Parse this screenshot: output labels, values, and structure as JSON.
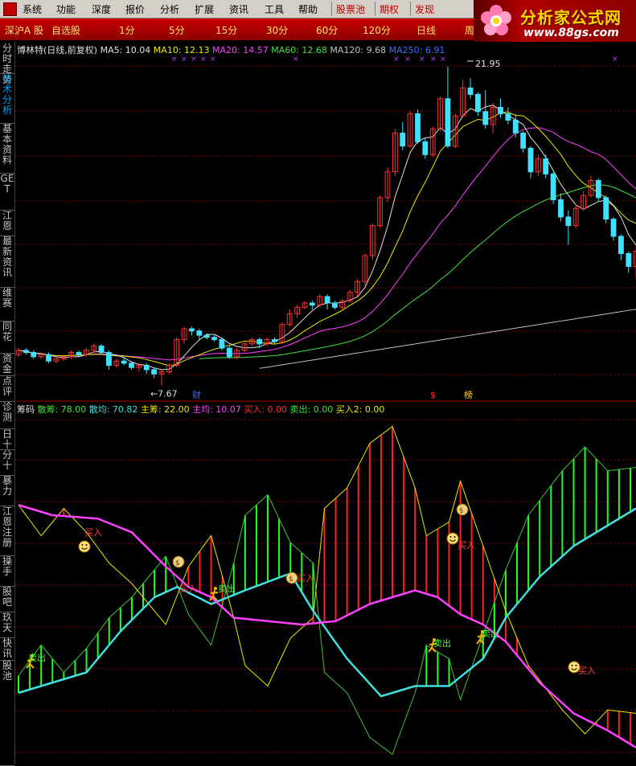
{
  "menu": {
    "items": [
      "系统",
      "功能",
      "深度",
      "报价",
      "分析",
      "扩展",
      "资讯",
      "工具",
      "帮助"
    ],
    "special": [
      "股票池",
      "期权",
      "发现"
    ]
  },
  "tabs": {
    "items": [
      "深沪A 股",
      "自选股",
      "1分",
      "5分",
      "15分",
      "30分",
      "60分",
      "120分",
      "日线",
      "周"
    ]
  },
  "logo": {
    "title": "分析家公式网",
    "url": "www.88gs.com"
  },
  "side_tabs": [
    {
      "label": "分时走势",
      "active": false
    },
    {
      "label": "技术分析",
      "active": true
    },
    {
      "label": "基本资料",
      "active": false
    },
    {
      "label": "GET",
      "active": false
    },
    {
      "label": "江恩",
      "active": false
    },
    {
      "label": "最新资讯",
      "active": false
    },
    {
      "label": "维赛",
      "active": false
    },
    {
      "label": "同花",
      "active": false
    },
    {
      "label": "资金",
      "active": false
    },
    {
      "label": "点评",
      "active": false
    },
    {
      "label": "诊测",
      "active": false
    },
    {
      "label": "日十",
      "active": false
    },
    {
      "label": "分十",
      "active": false
    },
    {
      "label": "暴力",
      "active": false
    },
    {
      "label": "江恩注册",
      "active": false
    },
    {
      "label": "操手",
      "active": false
    },
    {
      "label": "股吧",
      "active": false
    },
    {
      "label": "玖天",
      "active": false
    },
    {
      "label": "快讯",
      "active": false
    },
    {
      "label": "股池",
      "active": false
    }
  ],
  "upper": {
    "title": "博林特(日线,前复权)",
    "ma": [
      {
        "label": "MA5: 10.04",
        "color": "#e0e0e0"
      },
      {
        "label": "MA10: 12.13",
        "color": "#e8e800"
      },
      {
        "label": "MA20: 14.57",
        "color": "#ff40ff"
      },
      {
        "label": "MA60: 12.68",
        "color": "#40e040"
      },
      {
        "label": "MA120: 9.68",
        "color": "#c0c0c0"
      },
      {
        "label": "MA250: 6.91",
        "color": "#3a6fff"
      }
    ],
    "high_label": "21.95",
    "low_label": "7.67",
    "markers": [
      "财",
      "$",
      "榜"
    ]
  },
  "lower": {
    "title": "筹码",
    "legend": [
      {
        "label": "散筹: 78.00",
        "color": "#40e040"
      },
      {
        "label": "散均: 70.82",
        "color": "#40e0e0"
      },
      {
        "label": "主筹: 22.00",
        "color": "#e8e800"
      },
      {
        "label": "主均: 10.07",
        "color": "#ff40ff"
      },
      {
        "label": "买入: 0.00",
        "color": "#ff3030"
      },
      {
        "label": "卖出: 0.00",
        "color": "#40e040"
      },
      {
        "label": "买入2: 0.00",
        "color": "#e8e800"
      }
    ],
    "signal_buy": "买入",
    "signal_sell": "卖出"
  },
  "colors": {
    "up_candle": "#ff3030",
    "down_candle": "#40e0ff",
    "grid": "#8b0000"
  },
  "chart_data": {
    "type": "candlestick",
    "candles": [
      [
        9.1,
        9.3,
        9.4,
        9.0
      ],
      [
        9.3,
        9.2,
        9.4,
        9.1
      ],
      [
        9.2,
        9.0,
        9.3,
        8.9
      ],
      [
        9.0,
        9.1,
        9.2,
        8.9
      ],
      [
        9.1,
        8.8,
        9.2,
        8.7
      ],
      [
        8.8,
        8.9,
        9.0,
        8.7
      ],
      [
        8.9,
        9.0,
        9.1,
        8.8
      ],
      [
        9.0,
        9.2,
        9.3,
        8.9
      ],
      [
        9.2,
        9.1,
        9.3,
        9.0
      ],
      [
        9.1,
        9.3,
        9.4,
        9.0
      ],
      [
        9.3,
        9.5,
        9.6,
        9.2
      ],
      [
        9.5,
        9.2,
        9.6,
        9.1
      ],
      [
        9.2,
        8.6,
        9.3,
        8.4
      ],
      [
        8.6,
        8.8,
        8.9,
        8.5
      ],
      [
        8.8,
        8.7,
        9.0,
        8.6
      ],
      [
        8.7,
        8.5,
        8.8,
        8.4
      ],
      [
        8.5,
        8.6,
        8.7,
        8.3
      ],
      [
        8.6,
        8.4,
        8.7,
        8.2
      ],
      [
        8.4,
        8.2,
        8.5,
        8.0
      ],
      [
        8.2,
        8.3,
        8.4,
        7.67
      ],
      [
        8.3,
        8.6,
        8.7,
        8.2
      ],
      [
        8.6,
        9.8,
        9.9,
        8.5
      ],
      [
        9.8,
        10.3,
        10.4,
        9.6
      ],
      [
        10.3,
        10.2,
        10.4,
        10.0
      ],
      [
        10.2,
        10.0,
        10.3,
        9.8
      ],
      [
        10.0,
        9.9,
        10.1,
        9.8
      ],
      [
        9.9,
        9.8,
        10.0,
        9.7
      ],
      [
        9.8,
        9.4,
        9.9,
        9.3
      ],
      [
        9.4,
        9.0,
        9.5,
        8.9
      ],
      [
        9.0,
        9.3,
        9.4,
        8.9
      ],
      [
        9.3,
        9.6,
        9.7,
        9.2
      ],
      [
        9.6,
        9.8,
        9.9,
        9.5
      ],
      [
        9.8,
        9.6,
        9.9,
        9.4
      ],
      [
        9.6,
        9.8,
        9.9,
        9.5
      ],
      [
        9.8,
        9.7,
        9.9,
        9.6
      ],
      [
        9.7,
        10.5,
        10.6,
        9.6
      ],
      [
        10.5,
        11.0,
        11.2,
        10.4
      ],
      [
        11.0,
        11.3,
        11.4,
        10.8
      ],
      [
        11.3,
        11.5,
        11.6,
        11.2
      ],
      [
        11.5,
        11.4,
        11.6,
        11.2
      ],
      [
        11.4,
        11.8,
        11.9,
        11.3
      ],
      [
        11.8,
        11.5,
        11.9,
        11.2
      ],
      [
        11.5,
        11.3,
        11.6,
        11.2
      ],
      [
        11.3,
        11.6,
        11.7,
        11.2
      ],
      [
        11.6,
        12.0,
        12.1,
        11.5
      ],
      [
        12.0,
        12.5,
        12.6,
        11.8
      ],
      [
        12.5,
        13.7,
        13.8,
        12.3
      ],
      [
        13.7,
        15.1,
        15.2,
        13.5
      ],
      [
        15.1,
        16.4,
        16.5,
        15.0
      ],
      [
        16.4,
        17.6,
        17.8,
        16.2
      ],
      [
        17.6,
        19.4,
        19.6,
        17.4
      ],
      [
        19.4,
        18.8,
        19.9,
        18.6
      ],
      [
        18.8,
        20.3,
        20.4,
        18.7
      ],
      [
        20.3,
        19.0,
        20.5,
        18.9
      ],
      [
        19.0,
        18.4,
        19.2,
        18.2
      ],
      [
        18.4,
        19.6,
        19.7,
        18.3
      ],
      [
        19.6,
        21.0,
        21.1,
        19.5
      ],
      [
        21.0,
        18.8,
        22.5,
        18.7
      ],
      [
        18.8,
        20.2,
        20.3,
        18.7
      ],
      [
        20.2,
        21.5,
        21.9,
        20.1
      ],
      [
        21.5,
        21.2,
        21.95,
        21.0
      ],
      [
        21.2,
        20.4,
        21.3,
        20.2
      ],
      [
        20.4,
        19.8,
        21.4,
        19.6
      ],
      [
        19.8,
        20.6,
        20.8,
        19.4
      ],
      [
        20.6,
        20.3,
        21.0,
        20.1
      ],
      [
        20.3,
        20.0,
        20.6,
        19.8
      ],
      [
        20.0,
        19.4,
        20.3,
        19.2
      ],
      [
        19.4,
        18.7,
        19.5,
        18.5
      ],
      [
        18.7,
        17.6,
        18.8,
        17.3
      ],
      [
        17.6,
        18.2,
        18.4,
        17.4
      ],
      [
        18.2,
        17.5,
        18.4,
        17.3
      ],
      [
        17.5,
        16.3,
        17.6,
        16.1
      ],
      [
        16.3,
        15.5,
        16.6,
        15.3
      ],
      [
        15.5,
        15.1,
        15.8,
        14.2
      ],
      [
        15.1,
        15.9,
        16.1,
        15.0
      ],
      [
        15.9,
        16.5,
        16.7,
        15.8
      ],
      [
        16.5,
        17.2,
        17.4,
        16.4
      ],
      [
        17.2,
        16.4,
        17.3,
        16.2
      ],
      [
        16.4,
        15.4,
        16.5,
        15.2
      ],
      [
        15.4,
        14.6,
        15.5,
        14.4
      ],
      [
        14.6,
        13.8,
        14.7,
        13.5
      ],
      [
        13.8,
        13.2,
        13.9,
        12.9
      ],
      [
        13.2,
        13.9,
        14.1,
        12.6
      ]
    ],
    "y_range": [
      7.2,
      22.6
    ]
  }
}
